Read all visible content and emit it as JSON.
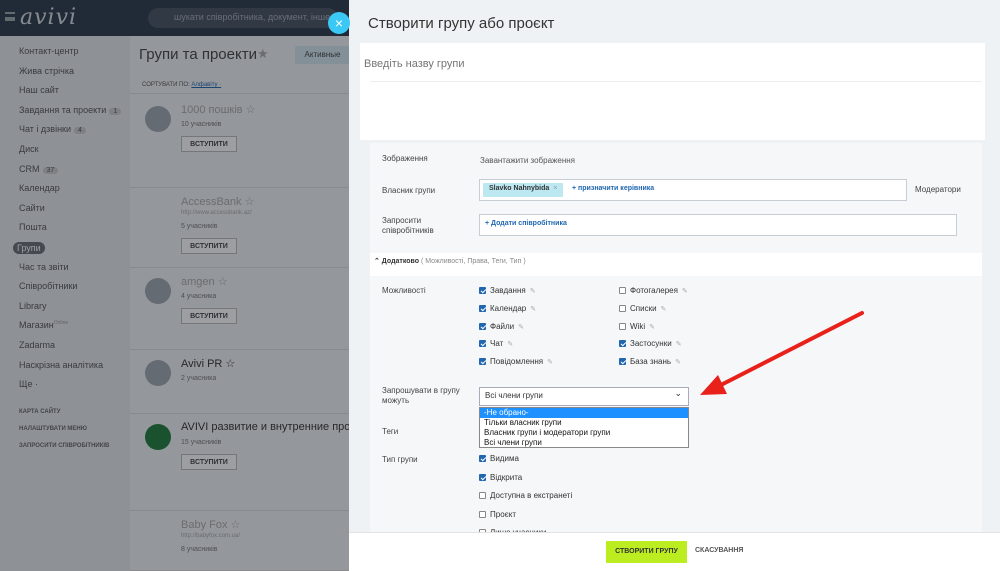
{
  "app": {
    "logo": "avivi",
    "search_placeholder": "шукати співробітника, документ, інше...",
    "close_icon": "×"
  },
  "sidebar": {
    "items": [
      {
        "label": "Контакт-центр"
      },
      {
        "label": "Жива стрічка"
      },
      {
        "label": "Наш сайт"
      },
      {
        "label": "Завдання та проекти",
        "badge": "1"
      },
      {
        "label": "Чат і дзвінки",
        "badge": "4"
      },
      {
        "label": "Диск"
      },
      {
        "label": "CRM",
        "badge": "37"
      },
      {
        "label": "Календар"
      },
      {
        "label": "Сайти"
      },
      {
        "label": "Пошта"
      },
      {
        "label": "Групи",
        "active": true
      },
      {
        "label": "Час та звіти"
      },
      {
        "label": "Співробітники"
      },
      {
        "label": "Library"
      },
      {
        "label": "Магазин",
        "sup": "Online"
      },
      {
        "label": "Zadarma"
      },
      {
        "label": "Наскрізна аналітика"
      },
      {
        "label": "Ще ·"
      }
    ],
    "links": [
      "КАРТА САЙТУ",
      "НАЛАШТУВАТИ МЕНЮ",
      "ЗАПРОСИТИ СПІВРОБІТНИКІВ"
    ]
  },
  "main": {
    "title": "Групи та проекти",
    "star": "★",
    "tab_active": "Активные",
    "sort_label": "СОРТУВАТИ ПО:",
    "sort_value": "Алфавіту ·",
    "groups": [
      {
        "name": "1000 пошків ☆",
        "url": "",
        "count": "10 учасників",
        "join": "ВСТУПИТИ"
      },
      {
        "name": "AccessBank ☆",
        "url": "http://www.accessbank.az/",
        "count": "5 учасників",
        "join": "ВСТУПИТИ"
      },
      {
        "name": "amgen ☆",
        "url": "",
        "count": "4 учасника",
        "join": "ВСТУПИТИ"
      },
      {
        "name": "Avivi PR ☆",
        "url": "",
        "count": "2 учасника",
        "join": ""
      },
      {
        "name": "AVIVI развитие и внутренние проекты",
        "url": "",
        "count": "15 учасників",
        "join": "ВСТУПИТИ"
      },
      {
        "name": "Baby Fox ☆",
        "url": "http://babyfox.com.ua/",
        "count": "8 учасників",
        "join": ""
      }
    ]
  },
  "panel": {
    "title": "Створити групу або проєкт",
    "name_placeholder": "Введіть назву групи",
    "image_label": "Зображення",
    "upload_label": "Завантажити зображення",
    "owner_label": "Власник групи",
    "owner_chip": "Slavko Nahnybida",
    "owner_chip_remove": "×",
    "owner_add": "+ призначити керівника",
    "moderators_label": "Модератори",
    "invite_staff_label": "Запросити співробітників",
    "invite_staff_add": "+ Додати співробітника",
    "advanced_label": "⌃ Додатково",
    "advanced_hint": "( Можливості, Права, Теги, Тип )",
    "features_label": "Можливості",
    "features_left": [
      {
        "label": "Завдання",
        "checked": true
      },
      {
        "label": "Календар",
        "checked": true
      },
      {
        "label": "Файли",
        "checked": true
      },
      {
        "label": "Чат",
        "checked": true
      },
      {
        "label": "Повідомлення",
        "checked": true
      }
    ],
    "features_right": [
      {
        "label": "Фотогалерея",
        "checked": false
      },
      {
        "label": "Списки",
        "checked": false
      },
      {
        "label": "Wiki",
        "checked": false
      },
      {
        "label": "Застосунки",
        "checked": true
      },
      {
        "label": "База знань",
        "checked": true
      }
    ],
    "invite_label": "Запрошувати в групу можуть",
    "invite_selected": "Всі члени групи",
    "invite_options": [
      {
        "label": "-Не обрано-",
        "highlighted": true
      },
      {
        "label": "Тільки власник групи"
      },
      {
        "label": "Власник групи і модератори групи"
      },
      {
        "label": "Всі члени групи"
      }
    ],
    "tags_label": "Теги",
    "type_label": "Тип групи",
    "types": [
      {
        "label": "Видима",
        "checked": true
      },
      {
        "label": "Відкрита",
        "checked": true
      },
      {
        "label": "Доступна в екстранеті",
        "checked": false
      },
      {
        "label": "Проєкт",
        "checked": false
      },
      {
        "label": "Лише учасники",
        "checked": false
      }
    ],
    "create_button": "СТВОРИТИ ГРУПУ",
    "cancel_button": "СКАСУВАННЯ"
  },
  "colors": {
    "accent_green": "#bbed21",
    "link_blue": "#2067b0",
    "arrow_red": "#e8211b",
    "select_highlight": "#1e90ff"
  }
}
